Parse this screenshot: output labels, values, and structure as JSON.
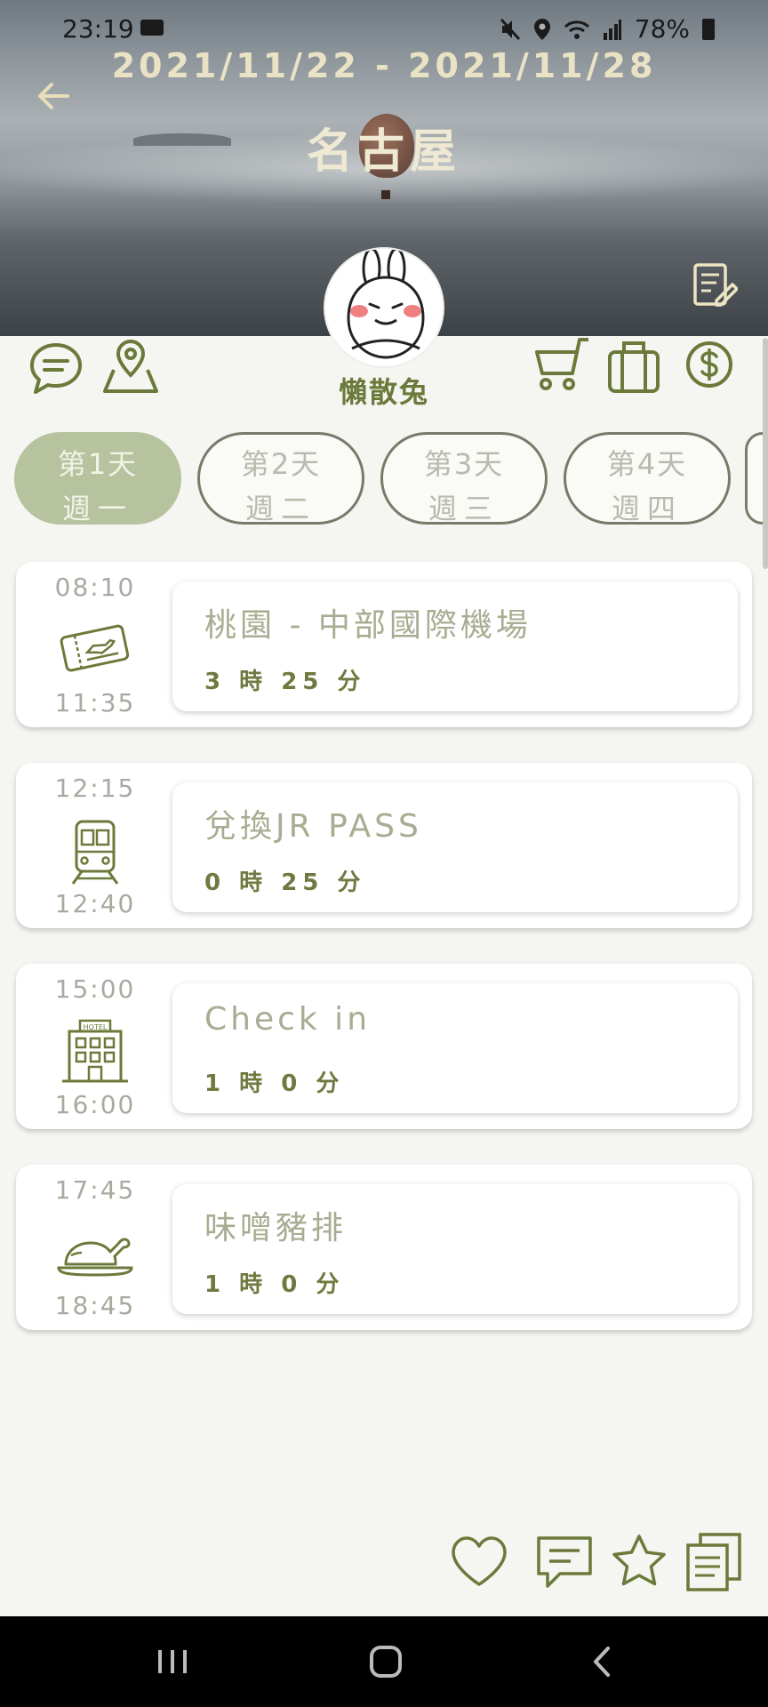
{
  "status": {
    "time": "23:19",
    "battery": "78%"
  },
  "header": {
    "date_range": "2021/11/22 - 2021/11/28",
    "city": "名古屋"
  },
  "user": {
    "name": "懶散兔"
  },
  "days": [
    {
      "day": "第1天",
      "weekday": "週一",
      "active": true
    },
    {
      "day": "第2天",
      "weekday": "週二",
      "active": false
    },
    {
      "day": "第3天",
      "weekday": "週三",
      "active": false
    },
    {
      "day": "第4天",
      "weekday": "週四",
      "active": false
    }
  ],
  "events": [
    {
      "start": "08:10",
      "end": "11:35",
      "title": "桃園 - 中部國際機場",
      "duration": "3 時 25 分",
      "icon": "ticket-icon"
    },
    {
      "start": "12:15",
      "end": "12:40",
      "title": "兌換JR PASS",
      "duration": "0 時 25 分",
      "icon": "train-icon"
    },
    {
      "start": "15:00",
      "end": "16:00",
      "title": "Check in",
      "duration": "1 時 0 分",
      "icon": "hotel-icon"
    },
    {
      "start": "17:45",
      "end": "18:45",
      "title": "味噌豬排",
      "duration": "1 時 0 分",
      "icon": "food-icon"
    }
  ],
  "colors": {
    "accent": "#6b7a3a",
    "active_tab": "#b7c39e",
    "title_muted": "#a7ad92"
  }
}
